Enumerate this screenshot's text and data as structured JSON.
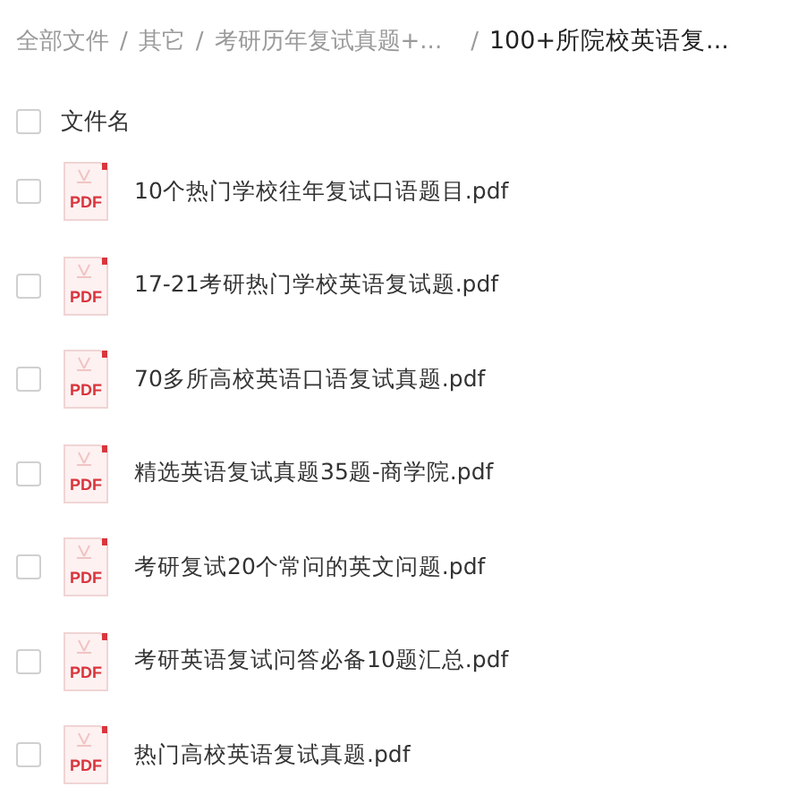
{
  "breadcrumb": {
    "separator": "/",
    "items": [
      {
        "label": "全部文件",
        "current": false
      },
      {
        "label": "其它",
        "current": false
      },
      {
        "label": "考研历年复试真题+...",
        "current": false
      },
      {
        "label": "100+所院校英语复...",
        "current": true
      }
    ]
  },
  "header": {
    "label": "文件名",
    "checked": false
  },
  "files": [
    {
      "name": "10个热门学校往年复试口语题目.pdf",
      "icon_label": "PDF",
      "checked": false
    },
    {
      "name": "17-21考研热门学校英语复试题.pdf",
      "icon_label": "PDF",
      "checked": false
    },
    {
      "name": "70多所高校英语口语复试真题.pdf",
      "icon_label": "PDF",
      "checked": false
    },
    {
      "name": "精选英语复试真题35题-商学院.pdf",
      "icon_label": "PDF",
      "checked": false
    },
    {
      "name": "考研复试20个常问的英文问题.pdf",
      "icon_label": "PDF",
      "checked": false
    },
    {
      "name": "考研英语复试问答必备10题汇总.pdf",
      "icon_label": "PDF",
      "checked": false
    },
    {
      "name": "热门高校英语复试真题.pdf",
      "icon_label": "PDF",
      "checked": false
    }
  ]
}
